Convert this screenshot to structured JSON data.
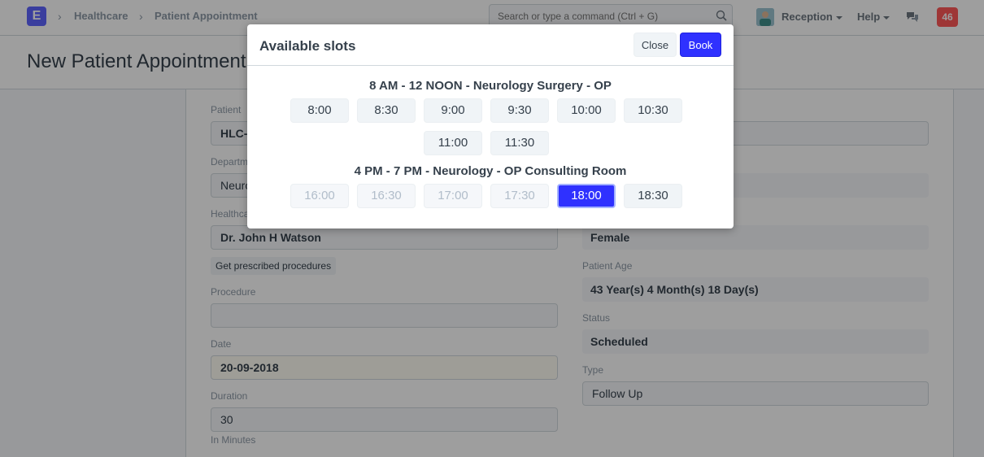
{
  "navbar": {
    "logo_letter": "E",
    "breadcrumbs": [
      "Healthcare",
      "Patient Appointment"
    ],
    "search_placeholder": "Search or type a command (Ctrl + G)",
    "user_label": "Reception",
    "help_label": "Help",
    "notification_count": "46"
  },
  "page": {
    "title": "New Patient Appointment 1"
  },
  "form": {
    "patient_label": "Patient",
    "patient_value": "HLC-",
    "department_label": "Departm",
    "department_value": "Neuro",
    "practitioner_label": "Healthca",
    "practitioner_value": "Dr. John H Watson",
    "get_procedures_label": "Get prescribed procedures",
    "procedure_label": "Procedure",
    "procedure_value": "",
    "date_label": "Date",
    "date_value": "20-09-2018",
    "duration_label": "Duration",
    "duration_value": "30",
    "duration_help": "In Minutes",
    "gender_value": "Female",
    "patient_age_label": "Patient Age",
    "patient_age_value": "43 Year(s) 4 Month(s) 18 Day(s)",
    "status_label": "Status",
    "status_value": "Scheduled",
    "type_label": "Type",
    "type_value": "Follow Up"
  },
  "modal": {
    "title": "Available slots",
    "close_label": "Close",
    "book_label": "Book",
    "schedules": [
      {
        "title": "8 AM - 12 NOON - Neurology Surgery - OP",
        "slots": [
          {
            "time": "8:00",
            "state": "available"
          },
          {
            "time": "8:30",
            "state": "available"
          },
          {
            "time": "9:00",
            "state": "available"
          },
          {
            "time": "9:30",
            "state": "available"
          },
          {
            "time": "10:00",
            "state": "available"
          },
          {
            "time": "10:30",
            "state": "available"
          },
          {
            "time": "11:00",
            "state": "available"
          },
          {
            "time": "11:30",
            "state": "available"
          }
        ]
      },
      {
        "title": "4 PM - 7 PM - Neurology - OP Consulting Room",
        "slots": [
          {
            "time": "16:00",
            "state": "disabled"
          },
          {
            "time": "16:30",
            "state": "disabled"
          },
          {
            "time": "17:00",
            "state": "disabled"
          },
          {
            "time": "17:30",
            "state": "disabled"
          },
          {
            "time": "18:00",
            "state": "selected"
          },
          {
            "time": "18:30",
            "state": "available"
          }
        ]
      }
    ]
  },
  "colors": {
    "primary": "#2f31ff",
    "logo": "#5e64ff",
    "notification": "#ff5858"
  }
}
